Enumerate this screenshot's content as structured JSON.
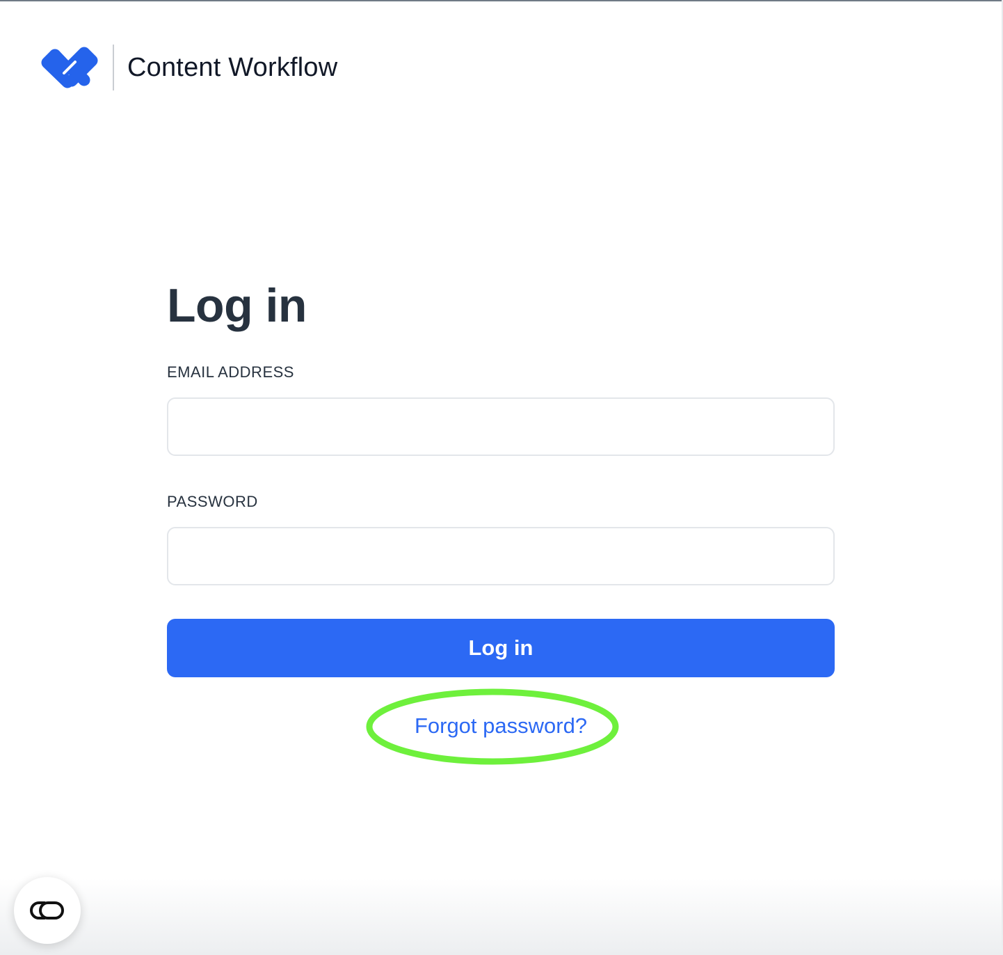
{
  "brand": {
    "logo_icon": "content-workflow-logo",
    "name": "Content Workflow"
  },
  "form": {
    "title": "Log in",
    "email_label": "EMAIL ADDRESS",
    "email_value": "",
    "password_label": "PASSWORD",
    "password_value": "",
    "submit_label": "Log in",
    "forgot_label": "Forgot password?"
  },
  "widget": {
    "icon": "link-icon"
  },
  "colors": {
    "accent": "#2c69f4",
    "highlight_ring": "#6ef03c",
    "title": "#27323f"
  }
}
